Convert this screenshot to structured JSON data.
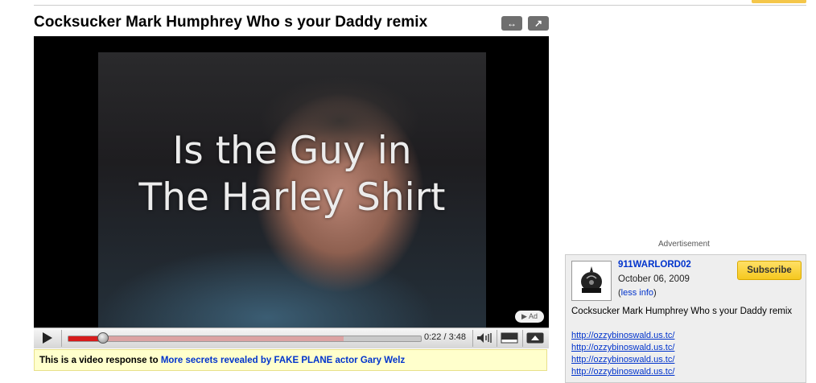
{
  "video": {
    "title": "Cocksucker Mark Humphrey Who s your Daddy remix",
    "overlay_line1": "Is the Guy in",
    "overlay_line2": "The Harley Shirt",
    "ad_badge": "▶ Ad",
    "current_time": "0:22",
    "duration": "3:48",
    "time_display": "0:22 / 3:48",
    "progress_fraction": 0.096,
    "loaded_fraction": 0.78,
    "title_button_icons": [
      "expand-arrows-icon",
      "popout-icon"
    ],
    "control_icons": [
      "play-icon",
      "volume-icon",
      "size-toggle-icon",
      "expand-up-icon"
    ]
  },
  "response": {
    "prefix": "This is a video response to",
    "link": "More secrets revealed by FAKE PLANE actor Gary Welz"
  },
  "sidebar": {
    "ad_label": "Advertisement",
    "channel": {
      "name": "911WARLORD02",
      "date": "October 06, 2009",
      "less_info_open": "(",
      "less_info": "less info",
      "less_info_close": ")",
      "subscribe": "Subscribe",
      "description": "Cocksucker Mark Humphrey Who s your Daddy remix",
      "links": [
        "http://ozzybinoswald.us.tc/",
        "http://ozzybinoswald.us.tc/",
        "http://ozzybinoswald.us.tc/",
        "http://ozzybinoswald.us.tc/"
      ]
    }
  },
  "colors": {
    "link": "#0033cc",
    "progress": "#d61b1b",
    "subscribe": "#f5c81f",
    "response_bg": "#ffffcc"
  }
}
